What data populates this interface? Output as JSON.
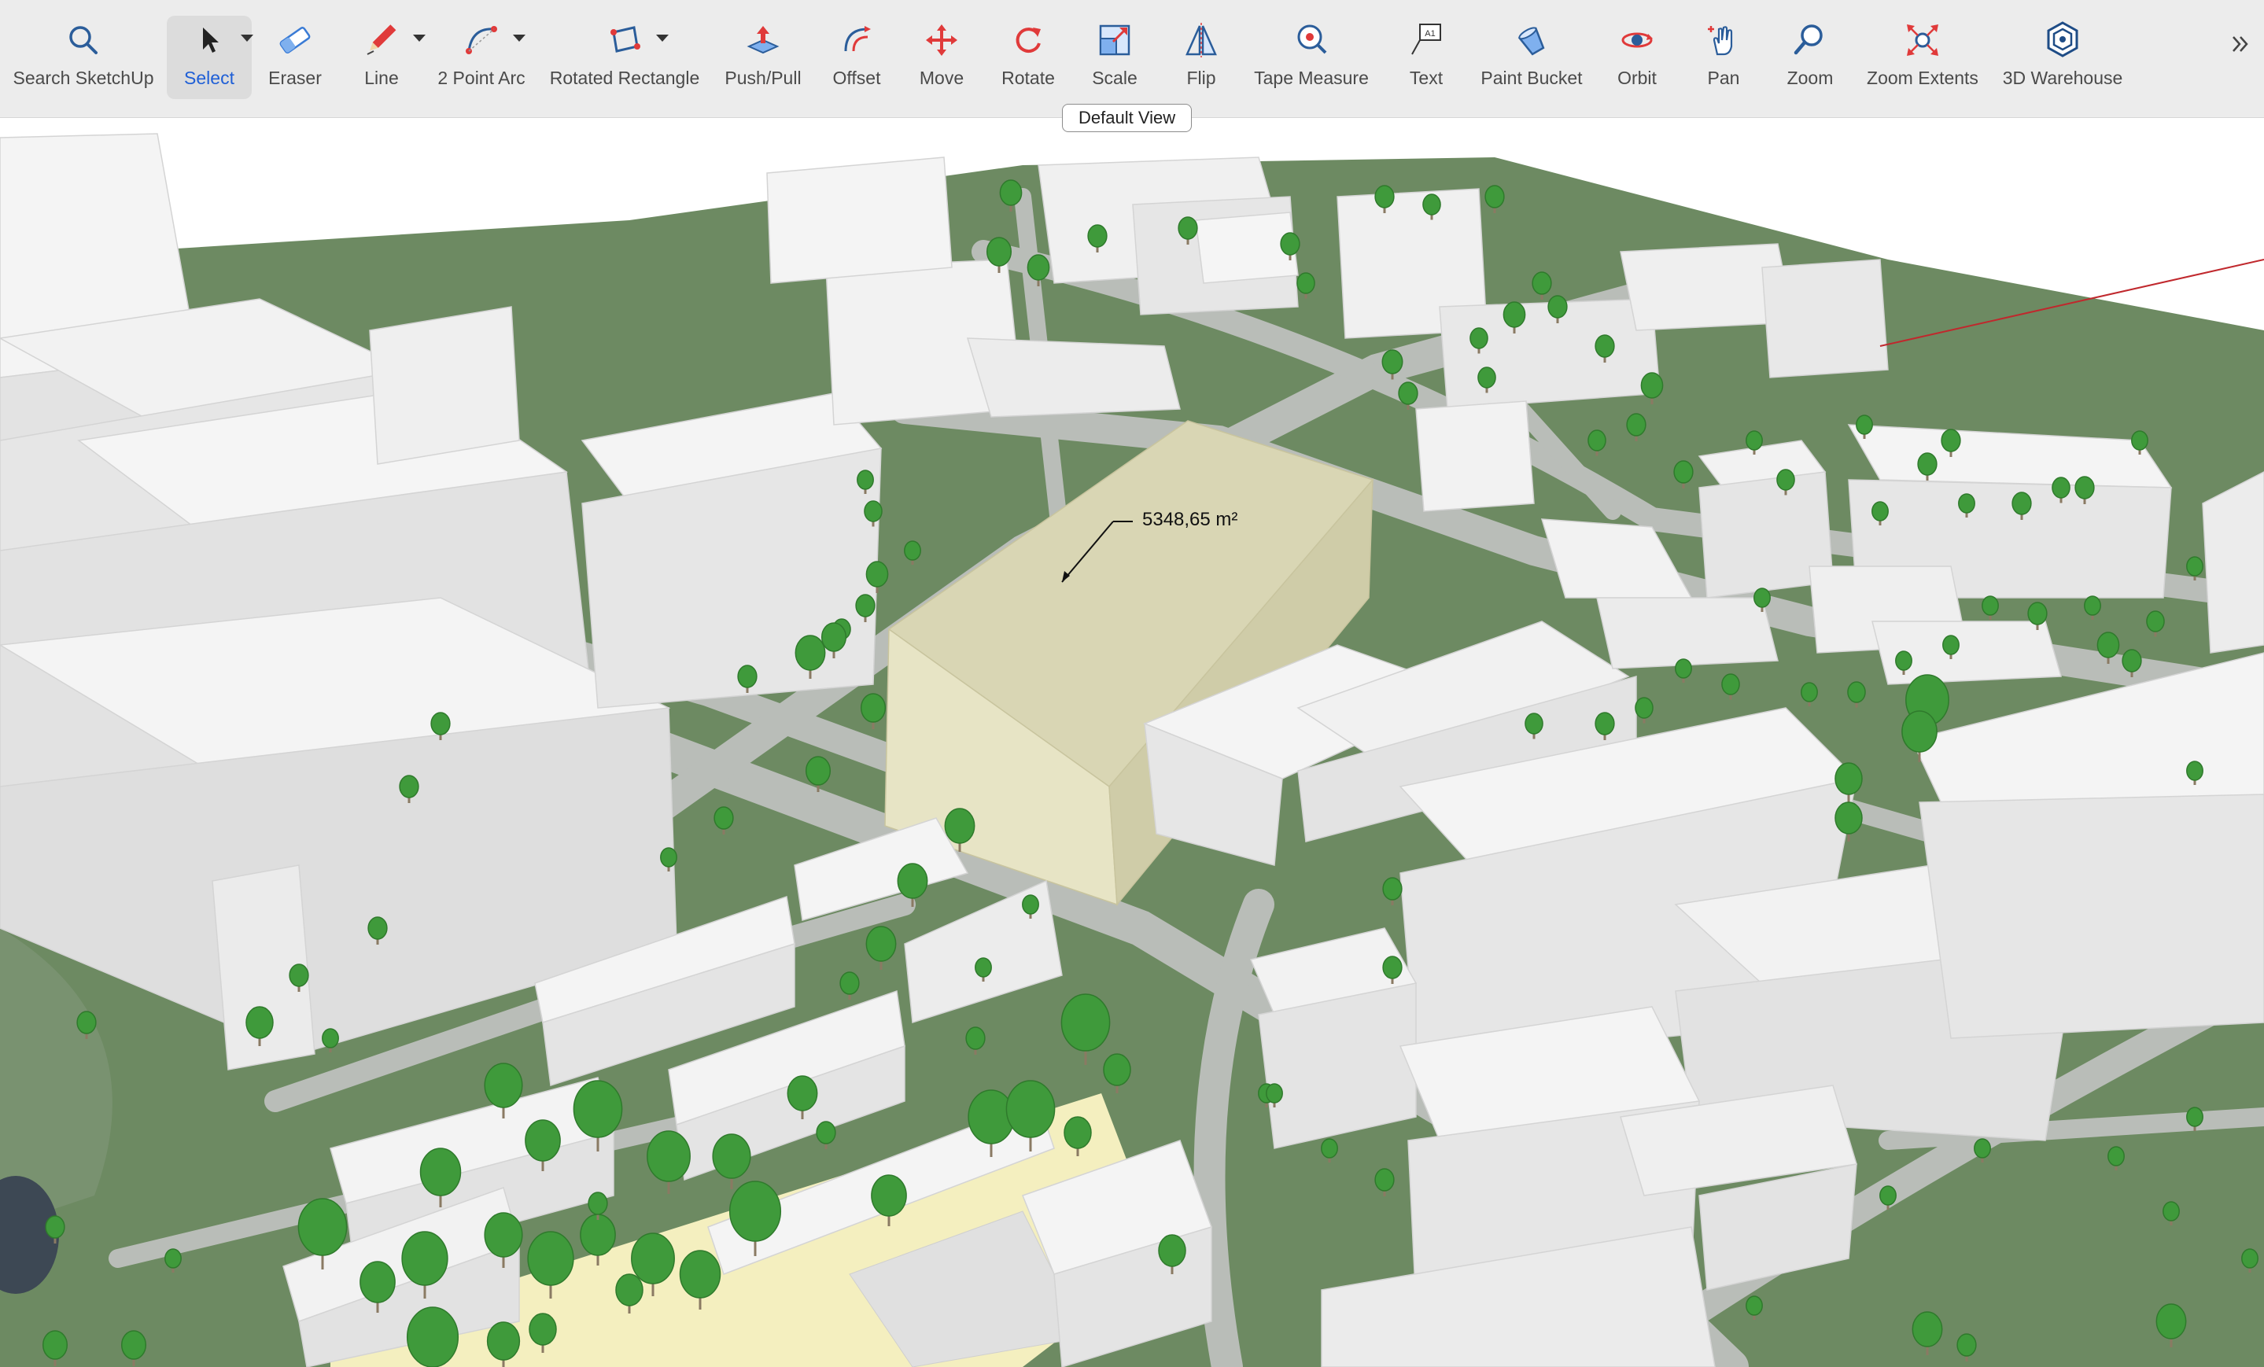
{
  "toolbar": {
    "tools": [
      {
        "label": "Search SketchUp",
        "icon": "search-icon"
      },
      {
        "label": "Select",
        "icon": "select-arrow-icon"
      },
      {
        "label": "Eraser",
        "icon": "eraser-icon"
      },
      {
        "label": "Line",
        "icon": "pencil-line-icon"
      },
      {
        "label": "2 Point Arc",
        "icon": "arc-icon"
      },
      {
        "label": "Rotated Rectangle",
        "icon": "rotated-rectangle-icon"
      },
      {
        "label": "Push/Pull",
        "icon": "push-pull-icon"
      },
      {
        "label": "Offset",
        "icon": "offset-icon"
      },
      {
        "label": "Move",
        "icon": "move-icon"
      },
      {
        "label": "Rotate",
        "icon": "rotate-icon"
      },
      {
        "label": "Scale",
        "icon": "scale-icon"
      },
      {
        "label": "Flip",
        "icon": "flip-icon"
      },
      {
        "label": "Tape Measure",
        "icon": "tape-measure-icon"
      },
      {
        "label": "Text",
        "icon": "text-icon"
      },
      {
        "label": "Paint Bucket",
        "icon": "paint-bucket-icon"
      },
      {
        "label": "Orbit",
        "icon": "orbit-icon"
      },
      {
        "label": "Pan",
        "icon": "pan-hand-icon"
      },
      {
        "label": "Zoom",
        "icon": "zoom-icon"
      },
      {
        "label": "Zoom Extents",
        "icon": "zoom-extents-icon"
      },
      {
        "label": "3D Warehouse",
        "icon": "3d-warehouse-icon"
      }
    ],
    "selected_tool": "Select",
    "more_icon": "chevron-double-right-icon"
  },
  "tooltip": {
    "text": "Default View"
  },
  "viewport": {
    "dimension_label": "5348,65 m²",
    "colors": {
      "ground": "#6d8a62",
      "road": "#b9bdb8",
      "building": "#efefef",
      "selected_building": "#d9d6b4",
      "tree": "#3f9a3b",
      "plaza": "#f4efbf",
      "axis": "#c0282d"
    }
  }
}
